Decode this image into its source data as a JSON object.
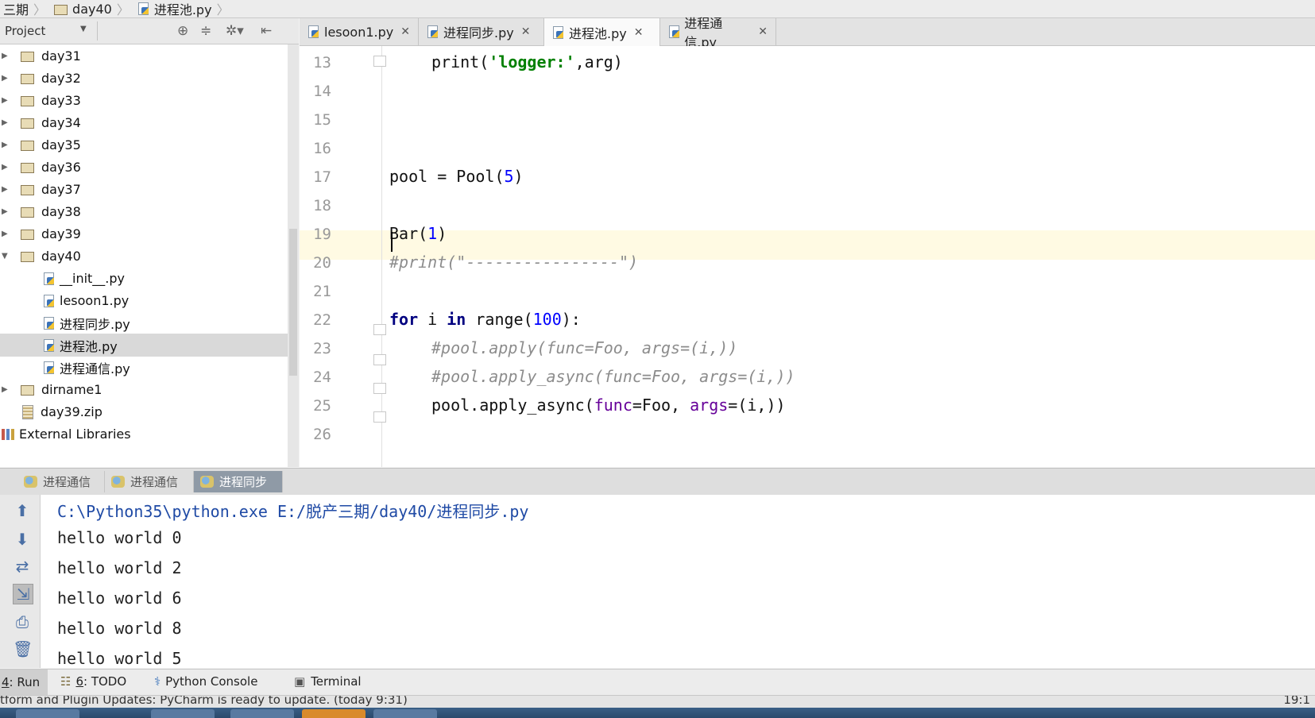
{
  "breadcrumb": [
    {
      "label": "三期",
      "icon": "folder-icon"
    },
    {
      "label": "day40",
      "icon": "folder-icon"
    },
    {
      "label": "进程池.py",
      "icon": "python-file-icon"
    }
  ],
  "project_panel": {
    "title": "Project",
    "toolbar_icons": [
      "target-icon",
      "collapse-icon",
      "gear-icon",
      "hide-panel-icon"
    ],
    "tree": [
      {
        "label": "day31",
        "type": "folder",
        "expanded": false
      },
      {
        "label": "day32",
        "type": "folder",
        "expanded": false
      },
      {
        "label": "day33",
        "type": "folder",
        "expanded": false
      },
      {
        "label": "day34",
        "type": "folder",
        "expanded": false
      },
      {
        "label": "day35",
        "type": "folder",
        "expanded": false
      },
      {
        "label": "day36",
        "type": "folder",
        "expanded": false
      },
      {
        "label": "day37",
        "type": "folder",
        "expanded": false
      },
      {
        "label": "day38",
        "type": "folder",
        "expanded": false
      },
      {
        "label": "day39",
        "type": "folder",
        "expanded": false
      },
      {
        "label": "day40",
        "type": "folder",
        "expanded": true
      },
      {
        "label": "__init__.py",
        "type": "py"
      },
      {
        "label": "lesoon1.py",
        "type": "py"
      },
      {
        "label": "进程同步.py",
        "type": "py"
      },
      {
        "label": "进程池.py",
        "type": "py",
        "selected": true
      },
      {
        "label": "进程通信.py",
        "type": "py"
      },
      {
        "label": "dirname1",
        "type": "folder",
        "expanded": false
      },
      {
        "label": "day39.zip",
        "type": "zip"
      },
      {
        "label": "External Libraries",
        "type": "lib"
      }
    ]
  },
  "editor_tabs": [
    {
      "label": "lesoon1.py",
      "active": false
    },
    {
      "label": "进程同步.py",
      "active": false
    },
    {
      "label": "进程池.py",
      "active": true
    },
    {
      "label": "进程通信.py",
      "active": false
    }
  ],
  "editor": {
    "current_line": 19,
    "lines": [
      {
        "n": "13",
        "code": "print('logger:',arg)"
      },
      {
        "n": "14",
        "code": ""
      },
      {
        "n": "15",
        "code": ""
      },
      {
        "n": "16",
        "code": ""
      },
      {
        "n": "17",
        "code": "pool = Pool(5)"
      },
      {
        "n": "18",
        "code": ""
      },
      {
        "n": "19",
        "code": "Bar(1)"
      },
      {
        "n": "20",
        "code": "#print(\"----------------\")"
      },
      {
        "n": "21",
        "code": ""
      },
      {
        "n": "22",
        "code": "for i in range(100):"
      },
      {
        "n": "23",
        "code": "#pool.apply(func=Foo, args=(i,))"
      },
      {
        "n": "24",
        "code": "#pool.apply_async(func=Foo, args=(i,))"
      },
      {
        "n": "25",
        "code": "pool.apply_async(func=Foo, args=(i,))"
      },
      {
        "n": "26",
        "code": ""
      }
    ]
  },
  "run_tabs": [
    {
      "label": "进程通信",
      "active": false
    },
    {
      "label": "进程通信",
      "active": false
    },
    {
      "label": "进程同步",
      "active": true
    }
  ],
  "console": {
    "lines": [
      "C:\\Python35\\python.exe E:/脱产三期/day40/进程同步.py",
      "hello world 0",
      "hello world 2",
      "hello world 6",
      "hello world 8",
      "hello world 5"
    ],
    "side_icons": [
      "arrow-up-icon",
      "arrow-down-icon",
      "wrap-icon",
      "scroll-to-end-icon",
      "print-icon",
      "trash-icon"
    ]
  },
  "bottom_tools": [
    {
      "num": "4",
      "label": ": Run",
      "active": true
    },
    {
      "num": "6",
      "label": ": TODO",
      "active": false
    },
    {
      "num": "",
      "label": "Python Console",
      "active": false
    },
    {
      "num": "",
      "label": "Terminal",
      "active": false
    }
  ],
  "status": {
    "message": "tform and Plugin Updates: PyCharm is ready to update. (today 9:31)",
    "position": "19:1"
  },
  "colors": {
    "keyword": "#000080",
    "string": "#008000",
    "number": "#0000ff",
    "comment": "#8c8c8c",
    "kwarg": "#660099",
    "current_line": "#fffae3",
    "run_tab_active": "#8f9aa6"
  }
}
